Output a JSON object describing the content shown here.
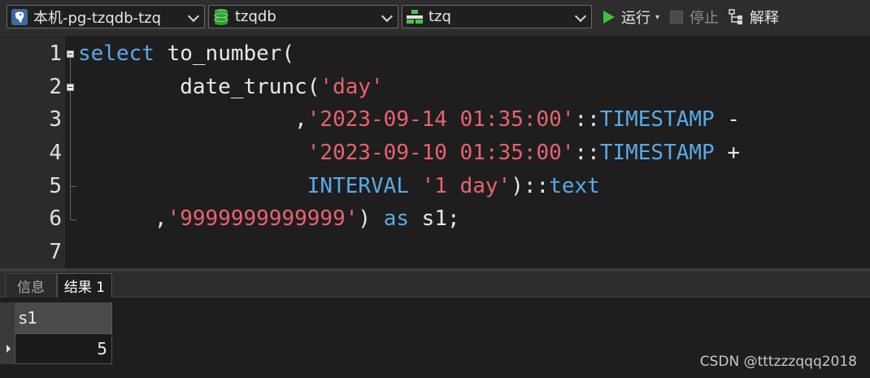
{
  "toolbar": {
    "connection": {
      "label": "本机-pg-tzqdb-tzq",
      "icon": "postgresql-elephant-icon"
    },
    "database": {
      "label": "tzqdb",
      "icon": "database-icon"
    },
    "schema": {
      "label": "tzq",
      "icon": "schema-icon"
    },
    "run_label": "运行",
    "stop_label": "停止",
    "explain_label": "解释",
    "colors": {
      "run": "#3fbf3f",
      "db_green": "#3cb043"
    }
  },
  "editor": {
    "line_numbers": [
      "1",
      "2",
      "3",
      "4",
      "5",
      "6",
      "7"
    ],
    "lines": [
      {
        "tokens": [
          {
            "t": "select",
            "k": "kw"
          },
          {
            "t": " to_number(",
            "k": "pun"
          }
        ]
      },
      {
        "tokens": [
          {
            "t": "        date_trunc(",
            "k": "pun"
          },
          {
            "t": "'day'",
            "k": "str"
          }
        ]
      },
      {
        "tokens": [
          {
            "t": "                 ,",
            "k": "pun"
          },
          {
            "t": "'2023-09-14 01:35:00'",
            "k": "str"
          },
          {
            "t": "::",
            "k": "pun"
          },
          {
            "t": "TIMESTAMP",
            "k": "kw"
          },
          {
            "t": " -",
            "k": "pun"
          }
        ]
      },
      {
        "tokens": [
          {
            "t": "                  ",
            "k": "pun"
          },
          {
            "t": "'2023-09-10 01:35:00'",
            "k": "str"
          },
          {
            "t": "::",
            "k": "pun"
          },
          {
            "t": "TIMESTAMP",
            "k": "kw"
          },
          {
            "t": " +",
            "k": "pun"
          }
        ]
      },
      {
        "tokens": [
          {
            "t": "                  ",
            "k": "pun"
          },
          {
            "t": "INTERVAL",
            "k": "kw"
          },
          {
            "t": " ",
            "k": "pun"
          },
          {
            "t": "'1 day'",
            "k": "str"
          },
          {
            "t": ")::",
            "k": "pun"
          },
          {
            "t": "text",
            "k": "kw"
          }
        ]
      },
      {
        "tokens": [
          {
            "t": "      ,",
            "k": "pun"
          },
          {
            "t": "'9999999999999'",
            "k": "str"
          },
          {
            "t": ") ",
            "k": "pun"
          },
          {
            "t": "as",
            "k": "kw"
          },
          {
            "t": " s1;",
            "k": "pun"
          }
        ]
      },
      {
        "tokens": []
      }
    ]
  },
  "tabs": [
    {
      "label": "信息",
      "active": false
    },
    {
      "label": "结果 1",
      "active": true
    }
  ],
  "result": {
    "columns": [
      "s1"
    ],
    "rows": [
      [
        "5"
      ]
    ]
  },
  "watermark": "CSDN @tttzzzqqq2018"
}
